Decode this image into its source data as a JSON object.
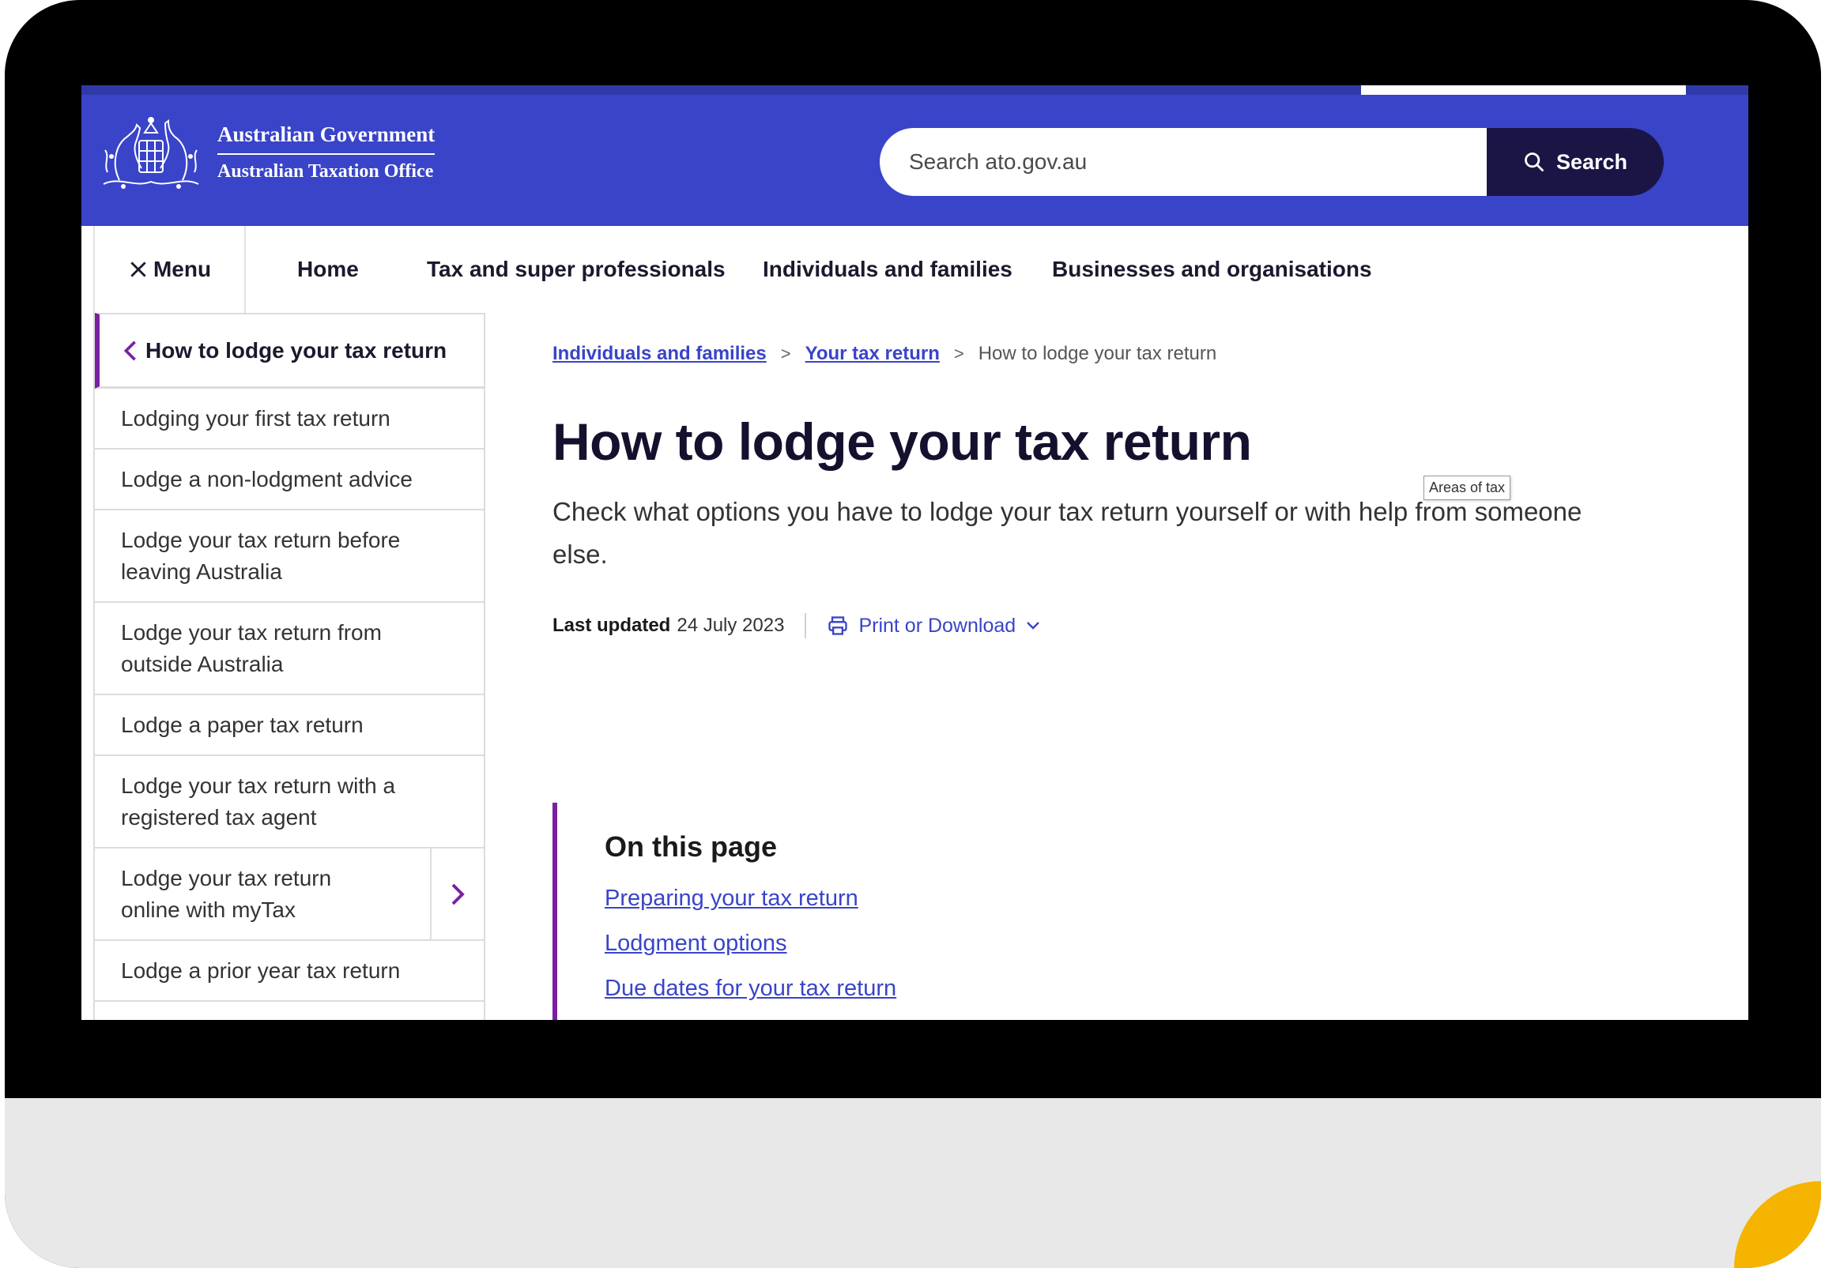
{
  "header": {
    "logo_line1": "Australian Government",
    "logo_line2": "Australian Taxation Office",
    "search_placeholder": "Search ato.gov.au",
    "search_button": "Search"
  },
  "nav": {
    "menu_label": "Menu",
    "items": [
      "Home",
      "Tax and super professionals",
      "Individuals and families",
      "Businesses and organisations"
    ]
  },
  "sidebar": {
    "heading": "How to lodge your tax return",
    "items": [
      {
        "line1": "Lodging your first tax return",
        "line2": ""
      },
      {
        "line1": "Lodge a non-lodgment advice",
        "line2": ""
      },
      {
        "line1": "Lodge your tax return before",
        "line2": "leaving Australia"
      },
      {
        "line1": "Lodge your tax return from",
        "line2": "outside Australia"
      },
      {
        "line1": "Lodge a paper tax return",
        "line2": ""
      },
      {
        "line1": "Lodge your tax return with a",
        "line2": "registered tax agent"
      },
      {
        "line1": "Lodge your tax return",
        "line2": "online with myTax"
      },
      {
        "line1": "Lodge a prior year tax return",
        "line2": ""
      }
    ]
  },
  "breadcrumb": {
    "items": [
      "Individuals and families",
      "Your tax return"
    ],
    "current": "How to lodge your tax return"
  },
  "page": {
    "title": "How to lodge your tax return",
    "lead": "Check what options you have to lodge your tax return yourself or with help from someone else.",
    "last_updated_label": "Last updated",
    "last_updated_value": "24 July 2023",
    "print_label": "Print or Download",
    "tooltip": "Areas of tax"
  },
  "on_this_page": {
    "title": "On this page",
    "links": [
      "Preparing your tax return",
      "Lodgment options",
      "Due dates for your tax return"
    ]
  },
  "colors": {
    "header_blue": "#3944c9",
    "search_button_navy": "#1b1546",
    "accent_purple": "#7b1fa2",
    "link_blue": "#3944c9"
  }
}
